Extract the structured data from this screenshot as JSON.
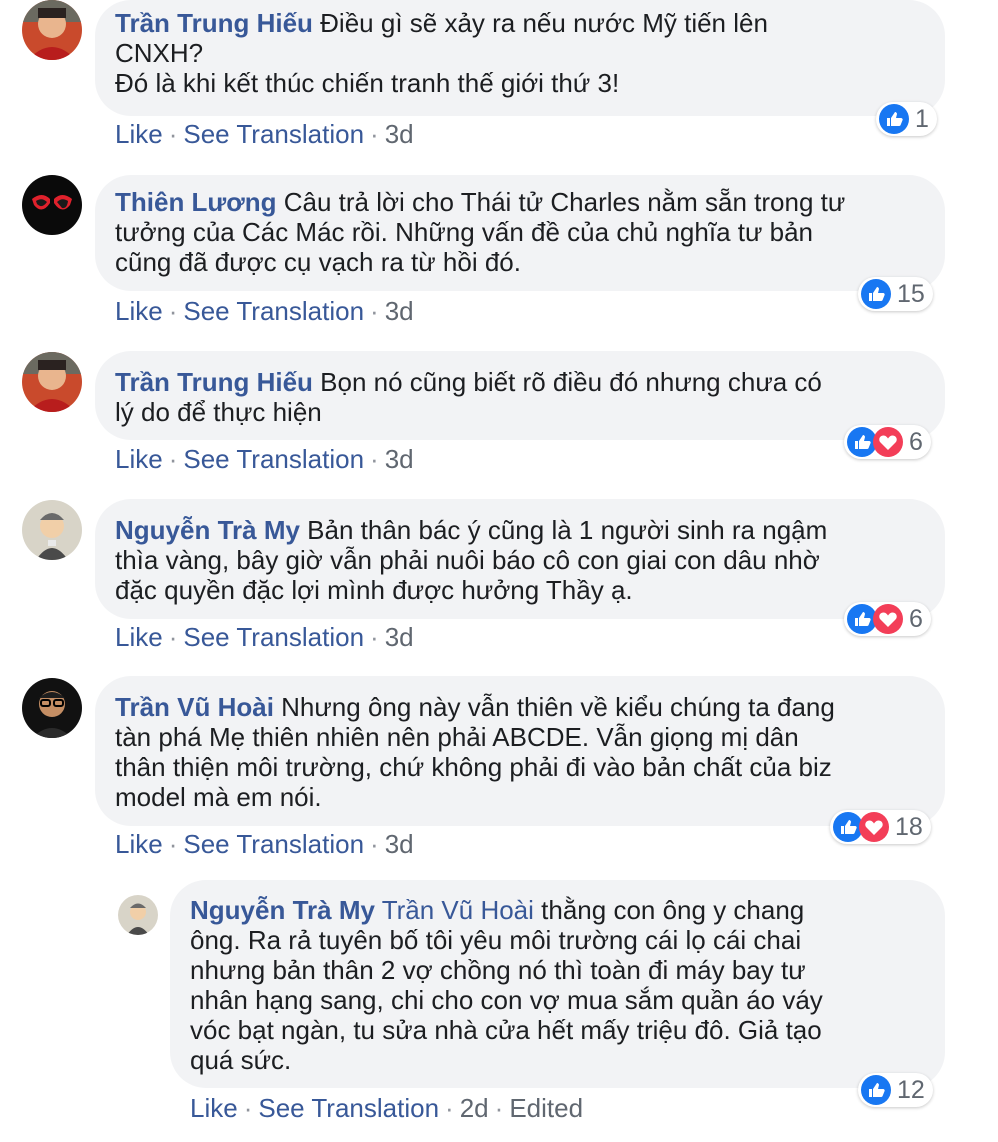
{
  "comments": [
    {
      "author": "Trần Trung Hiếu",
      "lines": [
        "Điều gì sẽ xảy ra nếu nước Mỹ tiến lên",
        "CNXH?",
        "Đó là khi kết thúc chiến tranh thế giới thứ 3!"
      ],
      "like": "Like",
      "translate": "See Translation",
      "time": "3d",
      "reaction_count": "1",
      "reaction_icons": [
        "like-icon"
      ]
    },
    {
      "author": "Thiên Lương",
      "lines": [
        "Câu trả lời cho Thái tử Charles nằm sẵn trong tư",
        "tưởng của Các Mác rồi. Những vấn đề của chủ nghĩa tư bản",
        "cũng đã được cụ vạch ra từ hồi đó."
      ],
      "like": "Like",
      "translate": "See Translation",
      "time": "3d",
      "reaction_count": "15",
      "reaction_icons": [
        "like-icon"
      ]
    },
    {
      "author": "Trần Trung Hiếu",
      "lines": [
        "Bọn nó cũng biết rõ điều đó nhưng chưa có",
        "lý do để thực hiện"
      ],
      "like": "Like",
      "translate": "See Translation",
      "time": "3d",
      "reaction_count": "6",
      "reaction_icons": [
        "like-icon",
        "love-icon"
      ]
    },
    {
      "author": "Nguyễn Trà My",
      "lines": [
        "Bản thân bác ý cũng là 1 người sinh ra ngậm",
        "thìa vàng, bây giờ vẫn phải nuôi báo cô con giai con dâu nhờ",
        "đặc quyền đặc lợi mình được hưởng Thầy ạ."
      ],
      "like": "Like",
      "translate": "See Translation",
      "time": "3d",
      "reaction_count": "6",
      "reaction_icons": [
        "like-icon",
        "love-icon"
      ]
    },
    {
      "author": "Trần Vũ Hoài",
      "lines": [
        "Nhưng ông này vẫn thiên về kiểu chúng ta đang",
        "tàn phá Mẹ thiên nhiên nên phải ABCDE. Vẫn giọng mị dân",
        "thân thiện môi trường, chứ không phải đi vào bản chất của biz",
        "model mà em nói."
      ],
      "like": "Like",
      "translate": "See Translation",
      "time": "3d",
      "reaction_count": "18",
      "reaction_icons": [
        "like-icon",
        "love-icon"
      ]
    },
    {
      "author": "Nguyễn Trà My",
      "mention": "Trần Vũ Hoài",
      "lines": [
        "thằng con ông y chang",
        "ông. Ra rả tuyên bố tôi yêu môi trường cái lọ cái chai",
        "nhưng bản thân 2 vợ chồng nó thì toàn đi máy bay tư",
        "nhân hạng sang, chi cho con vợ mua sắm quần áo váy",
        "vóc bạt ngàn, tu sửa nhà cửa hết mấy triệu đô. Giả tạo",
        "quá sức."
      ],
      "like": "Like",
      "translate": "See Translation",
      "time": "2d",
      "edited": "Edited",
      "reaction_count": "12",
      "reaction_icons": [
        "like-icon"
      ]
    }
  ],
  "colors": {
    "name": "#385898",
    "bubble": "#f2f3f5",
    "meta": "#606770",
    "like": "#1877f2",
    "love": "#f33e58"
  }
}
